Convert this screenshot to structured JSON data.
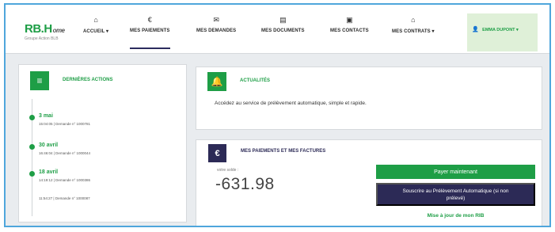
{
  "logo": {
    "main": "RB.H",
    "sup": "ome",
    "sub": "Groupe Action BLB"
  },
  "nav": [
    {
      "label": "ACCUEIL ▾",
      "icon": "home-icon"
    },
    {
      "label": "MES PAIEMENTS",
      "icon": "euro-icon"
    },
    {
      "label": "MES DEMANDES",
      "icon": "envelope-icon"
    },
    {
      "label": "MES DOCUMENTS",
      "icon": "document-icon"
    },
    {
      "label": "MES CONTACTS",
      "icon": "contact-card-icon"
    },
    {
      "label": "MES CONTRATS ▾",
      "icon": "house-contract-icon"
    }
  ],
  "user": {
    "name": "EMMA DUPONT ▾"
  },
  "last_actions": {
    "title": "DERNIÈRES ACTIONS",
    "items": [
      {
        "date": "3 mai",
        "desc": "15:04:05 | Demande n° 1000781"
      },
      {
        "date": "30 avril",
        "desc": "16:46:04 | Demande n° 1000044"
      },
      {
        "date": "18 avril",
        "desc": "14:19:12 | Demande n° 1000386"
      },
      {
        "date": "",
        "desc": "11:54:27 | Demande n° 1000087"
      }
    ]
  },
  "news": {
    "title": "ACTUALITÉS",
    "text": "Accédez au service de prélèvement automatique, simple et rapide."
  },
  "payments": {
    "title": "MES PAIEMENTS ET MES FACTURES",
    "balance_label": "votre solde :",
    "balance_value": "-631.98",
    "pay_button": "Payer maintenant",
    "sepa_button": "Souscrire au Prélèvement Automatique (si non prélevé)",
    "rib_link": "Mise à jour de mon RIB"
  },
  "colors": {
    "brand_green": "#1e9e46",
    "navy": "#2c2a56",
    "frame_border": "#4fa6dc"
  }
}
